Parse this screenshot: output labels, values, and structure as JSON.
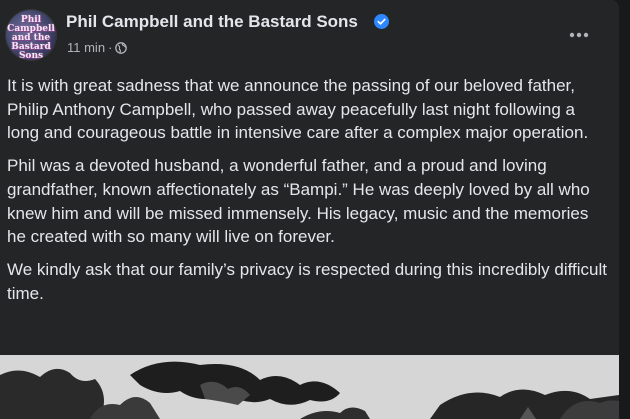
{
  "post": {
    "page_name": "Phil Campbell and the Bastard Sons",
    "avatar_text": "Phil\nCampbell\nand the\nBastard\nSons",
    "timestamp": "11 min",
    "separator": "·",
    "audience_icon": "globe-icon",
    "verified_icon": "verified-badge-icon",
    "more_icon": "more-options-icon",
    "paragraphs": [
      "It is with great sadness that we announce the passing of our beloved father, Philip Anthony Campbell, who passed away peacefully last night following a long and courageous battle in intensive care after a complex major operation.",
      "Phil was a devoted husband, a wonderful father, and a proud and loving grandfather, known affectionately as “Bampi.” He was deeply loved by all who knew him and will be missed immensely. His legacy, music and the memories he created with so many will live on forever.",
      "We kindly ask that our family’s privacy is respected during this incredibly difficult time."
    ]
  },
  "colors": {
    "background": "#18191a",
    "card": "#242526",
    "primary_text": "#e4e6eb",
    "secondary_text": "#b0b3b8",
    "verified_blue": "#2d88ff"
  }
}
